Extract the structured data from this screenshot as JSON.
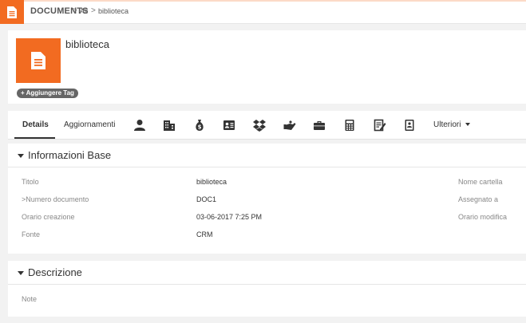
{
  "topbar": {
    "module_name": "DOCUMENTS",
    "crumb_all": "All",
    "crumb_record": "biblioteca",
    "separator": ">"
  },
  "record": {
    "name": "biblioteca",
    "add_tag_label": "Aggiungere Tag",
    "add_tag_plus": "+"
  },
  "tabs": {
    "details": "Details",
    "updates": "Aggiornamenti",
    "more": "Ulteriori",
    "icons": [
      "person-icon",
      "building-icon",
      "money-bag-icon",
      "contact-card-icon",
      "dropbox-icon",
      "handshake-icon",
      "briefcase-icon",
      "calculator-icon",
      "edit-note-icon",
      "contact-book-icon"
    ]
  },
  "info_panel": {
    "title": "Informazioni Base",
    "fields": {
      "title_label": "Titolo",
      "title_value": "biblioteca",
      "number_label": ">Numero documento",
      "number_value": "DOC1",
      "created_label": "Orario creazione",
      "created_value": "03-06-2017 7:25 PM",
      "source_label": "Fonte",
      "source_value": "CRM",
      "folder_label": "Nome cartella",
      "assigned_label": "Assegnato a",
      "modified_label": "Orario modifica"
    }
  },
  "description_panel": {
    "title": "Descrizione",
    "note_label": "Note"
  },
  "colors": {
    "accent": "#f26b21",
    "icon_dark": "#333333",
    "background": "#f2f2f2"
  }
}
